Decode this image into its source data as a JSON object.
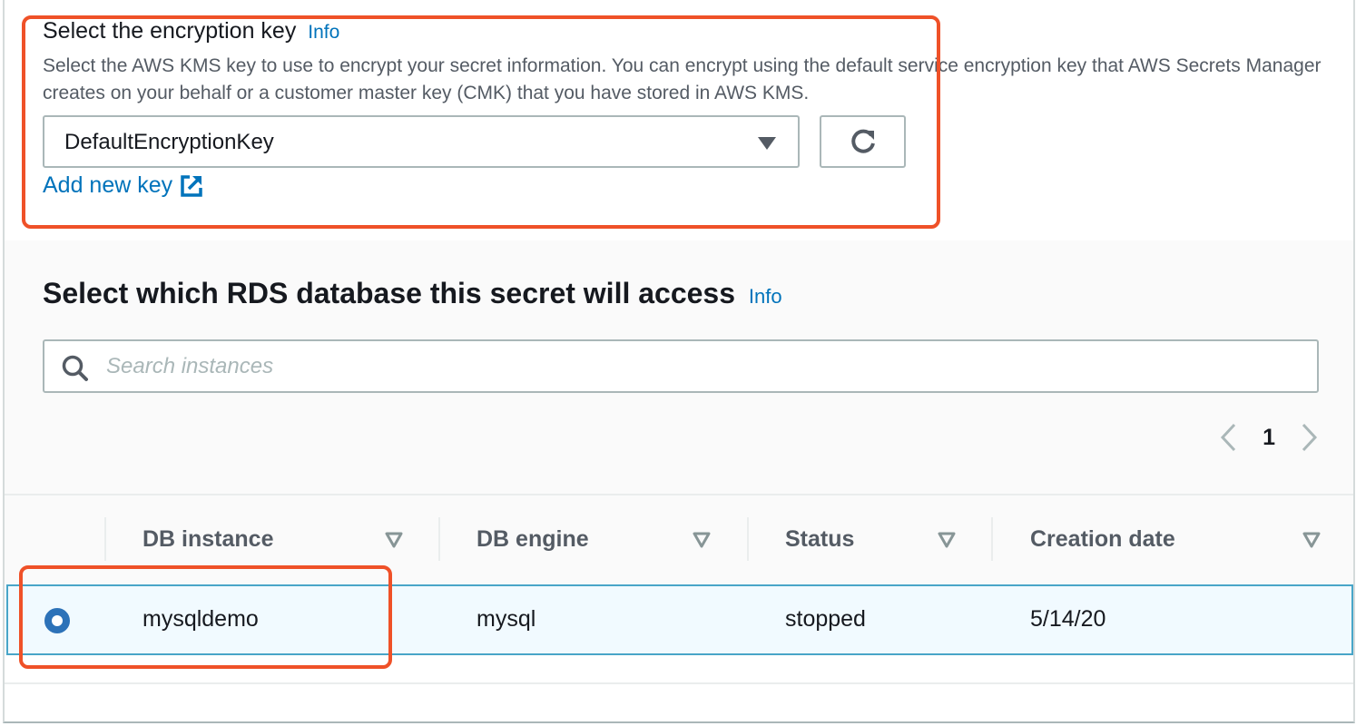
{
  "encryption": {
    "title": "Select the encryption key",
    "info_label": "Info",
    "description": "Select the AWS KMS key to use to encrypt your secret information. You can encrypt using the default service encryption key that AWS Secrets Manager creates on your behalf or a customer master key (CMK) that you have stored in AWS KMS.",
    "selected_key": "DefaultEncryptionKey",
    "add_key_label": "Add new key",
    "icons": {
      "caret": "caret-down-icon",
      "refresh": "refresh-icon",
      "external": "external-link-icon"
    }
  },
  "rds": {
    "title": "Select which RDS database this secret will access",
    "info_label": "Info",
    "search": {
      "value": "",
      "placeholder": "Search instances"
    },
    "pagination": {
      "current_page": "1"
    },
    "table": {
      "columns": [
        {
          "label": "DB instance"
        },
        {
          "label": "DB engine"
        },
        {
          "label": "Status"
        },
        {
          "label": "Creation date"
        }
      ],
      "rows": [
        {
          "selected": true,
          "db_instance": "mysqldemo",
          "db_engine": "mysql",
          "status": "stopped",
          "creation_date": "5/14/20"
        }
      ]
    }
  },
  "colors": {
    "link": "#0073bb",
    "highlight": "#ef5128",
    "selected_row_bg": "#f1faff",
    "selected_row_border": "#48a5c8",
    "radio": "#2d72b8"
  }
}
